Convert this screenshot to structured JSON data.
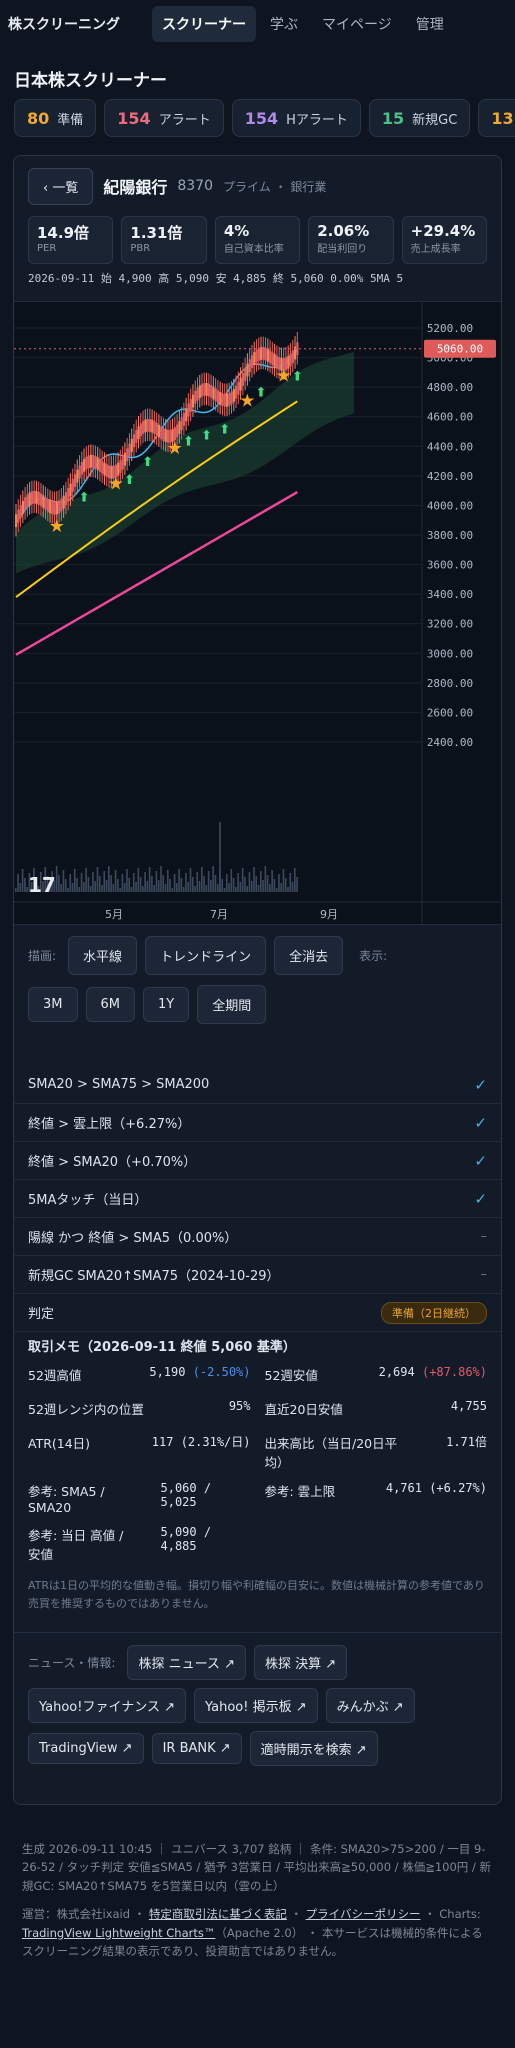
{
  "nav": {
    "brand": "株スクリーニング",
    "items": [
      "スクリーナー",
      "学ぶ",
      "マイページ",
      "管理"
    ]
  },
  "title": "日本株スクリーナー",
  "chips": [
    {
      "count": "80",
      "label": "準備",
      "color": "#f0a92e"
    },
    {
      "count": "154",
      "label": "アラート",
      "color": "#f06a7e"
    },
    {
      "count": "154",
      "label": "Hアラート",
      "color": "#b08ae8"
    },
    {
      "count": "15",
      "label": "新規GC",
      "color": "#4cc08a"
    },
    {
      "count": "13",
      "label": "",
      "color": "#f0a92e"
    }
  ],
  "stock": {
    "back": "‹ 一覧",
    "name": "紀陽銀行",
    "code": "8370",
    "meta": "プライム ・ 銀行業"
  },
  "stats": [
    {
      "value": "14.9倍",
      "label": "PER"
    },
    {
      "value": "1.31倍",
      "label": "PBR"
    },
    {
      "value": "4%",
      "label": "自己資本比率"
    },
    {
      "value": "2.06%",
      "label": "配当利回り"
    },
    {
      "value": "+29.4%",
      "label": "売上成長率"
    }
  ],
  "ohlc": "2026-09-11 始 4,900 高 5,090 安 4,885 終 5,060 0.00% 5MA 5",
  "chart_data": {
    "type": "candlestick",
    "price_label": "5060.00",
    "y_ticks": [
      "5200.00",
      "5000.00",
      "4800.00",
      "4600.00",
      "4400.00",
      "4200.00",
      "4000.00",
      "3800.00",
      "3600.00",
      "3400.00",
      "3200.00",
      "3000.00",
      "2800.00",
      "2600.00",
      "2400.00"
    ],
    "x_ticks": [
      "5月",
      "7月",
      "9月"
    ],
    "series": [
      {
        "name": "SMA20",
        "color": "#38bdf8"
      },
      {
        "name": "SMA75",
        "color": "#facc15"
      },
      {
        "name": "SMA200",
        "color": "#ec4899"
      }
    ]
  },
  "controls": {
    "draw_label": "描画:",
    "draw_buttons": [
      "水平線",
      "トレンドライン",
      "全消去"
    ],
    "view_label": "表示:",
    "range_buttons": [
      "3M",
      "6M",
      "1Y",
      "全期間"
    ]
  },
  "checks": [
    {
      "label": "SMA20 > SMA75 > SMA200",
      "status": "✓"
    },
    {
      "label": "終値 > 雲上限（+6.27%）",
      "status": "✓"
    },
    {
      "label": "終値 > SMA20（+0.70%）",
      "status": "✓"
    },
    {
      "label": "5MAタッチ（当日）",
      "status": "✓"
    },
    {
      "label": "陽線 かつ 終値 > SMA5（0.00%）",
      "status": "–"
    },
    {
      "label": "新規GC SMA20↑SMA75（2024-10-29）",
      "status": "–"
    }
  ],
  "verdict": {
    "label": "判定",
    "badge": "準備（2日継続）"
  },
  "memo": {
    "title": "取引メモ（2026-09-11 終値 5,060 基準）",
    "items": [
      {
        "k": "52週高値",
        "v": "5,190",
        "extra": "(-2.50%)"
      },
      {
        "k": "52週安値",
        "v": "2,694",
        "extra": "(+87.86%)"
      },
      {
        "k": "52週レンジ内の位置",
        "v": "95%",
        "extra": ""
      },
      {
        "k": "直近20日安値",
        "v": "4,755",
        "extra": ""
      },
      {
        "k": "ATR(14日)",
        "v": "117 (2.31%/日)",
        "extra": ""
      },
      {
        "k": "出来高比（当日/20日平均）",
        "v": "1.71倍",
        "extra": ""
      },
      {
        "k": "参考: SMA5 / SMA20",
        "v": "5,060 / 5,025",
        "extra": ""
      },
      {
        "k": "参考: 雲上限",
        "v": "4,761 (+6.27%)",
        "extra": ""
      },
      {
        "k": "参考: 当日 高値 / 安値",
        "v": "5,090 / 4,885",
        "extra": ""
      }
    ],
    "note": "ATRは1日の平均的な値動き幅。損切り幅や利確幅の目安に。数値は機械計算の参考値であり売買を推奨するものではありません。"
  },
  "news": {
    "label": "ニュース・情報:",
    "links": [
      "株探 ニュース ↗",
      "株探 決算 ↗",
      "Yahoo!ファイナンス ↗",
      "Yahoo! 掲示板 ↗",
      "みんかぶ ↗",
      "TradingView ↗",
      "IR BANK ↗",
      "適時開示を検索 ↗"
    ]
  },
  "footer": {
    "line1": "生成 2026-09-11 10:45 ｜ ユニバース 3,707 銘柄 ｜ 条件: SMA20>75>200 / 一目 9-26-52 / タッチ判定 安値≦SMA5 / 猶予 3営業日 / 平均出来高≧50,000 / 株価≧100円 / 新規GC: SMA20↑SMA75 を5営業日以内（雲の上）",
    "operator": "運営：株式会社ixaid ・",
    "link1": "特定商取引法に基づく表記",
    "link2": "プライバシーポリシー",
    "charts_prefix": "・ Charts:",
    "link3": "TradingView Lightweight Charts™",
    "tail": "（Apache 2.0） ・ 本サービスは機械的条件によるスクリーニング結果の表示であり、投資助言ではありません。"
  }
}
